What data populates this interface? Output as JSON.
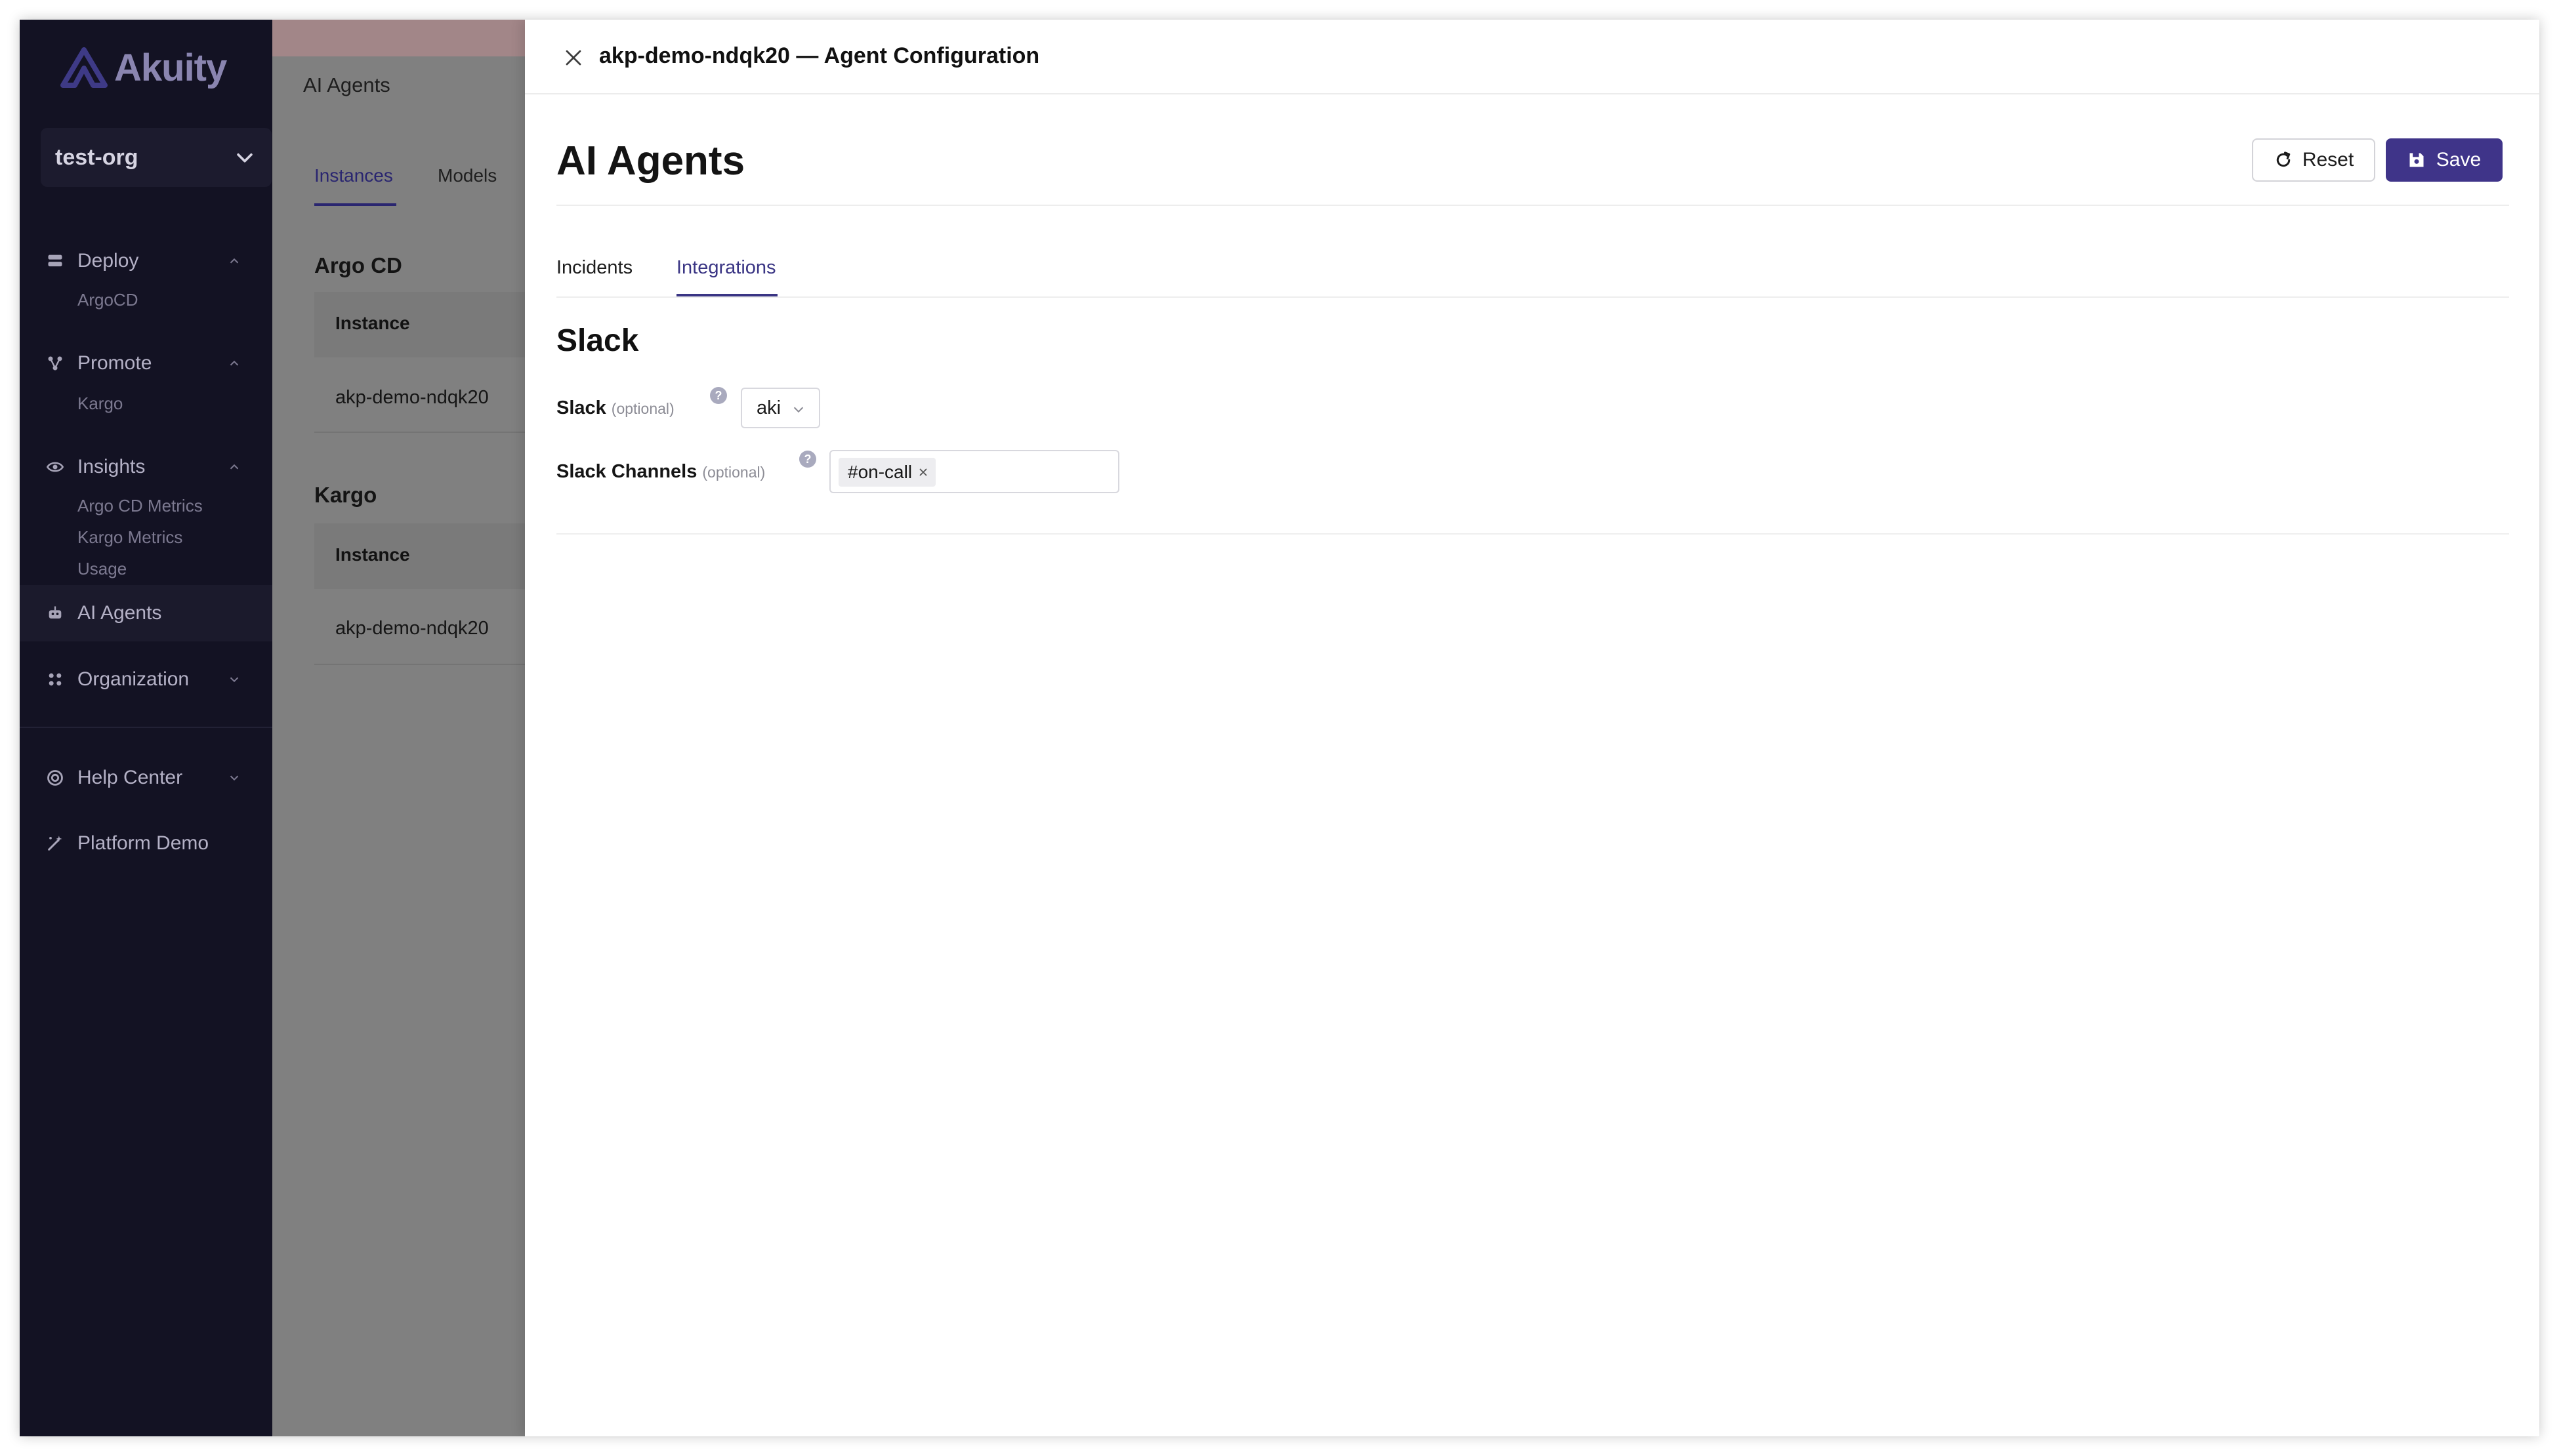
{
  "sidebar": {
    "logo_text": "Akuity",
    "org_name": "test-org",
    "groups": [
      {
        "label": "Deploy",
        "icon": "server-icon",
        "sub": [
          "ArgoCD"
        ]
      },
      {
        "label": "Promote",
        "icon": "nodes-icon",
        "sub": [
          "Kargo"
        ]
      },
      {
        "label": "Insights",
        "icon": "eye-icon",
        "sub": [
          "Argo CD Metrics",
          "Kargo Metrics",
          "Usage"
        ]
      }
    ],
    "ai_agents": "AI Agents",
    "organization": "Organization",
    "help_center": "Help Center",
    "platform_demo": "Platform Demo"
  },
  "background": {
    "title": "AI Agents",
    "tabs": [
      "Instances",
      "Models"
    ],
    "sections": [
      {
        "title": "Argo CD",
        "column": "Instance",
        "row": "akp-demo-ndqk20"
      },
      {
        "title": "Kargo",
        "column": "Instance",
        "row": "akp-demo-ndqk20"
      }
    ]
  },
  "drawer": {
    "title": "akp-demo-ndqk20 — Agent Configuration",
    "heading": "AI Agents",
    "reset_label": "Reset",
    "save_label": "Save",
    "tabs": [
      "Incidents",
      "Integrations"
    ],
    "active_tab": "Integrations",
    "section_title": "Slack",
    "slack": {
      "label": "Slack",
      "optional": "(optional)",
      "help": "?",
      "value": "aki"
    },
    "channels": {
      "label": "Slack Channels",
      "optional": "(optional)",
      "help": "?",
      "tags": [
        "#on-call"
      ]
    }
  },
  "colors": {
    "sidebar_bg": "#131223",
    "accent": "#3f3489",
    "active_tab": "#3a3584"
  }
}
